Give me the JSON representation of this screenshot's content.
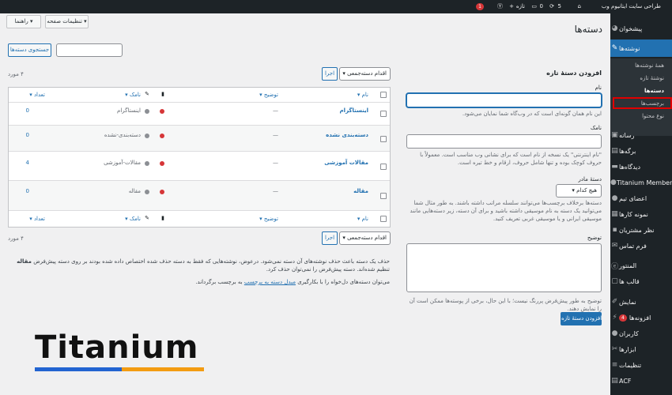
{
  "adminbar": {
    "site_name": "طراحی سایت ایتانیوم وب",
    "updates_count": "5",
    "comments_count": "0",
    "new_label": "تازه",
    "badge": "1"
  },
  "screen_buttons": {
    "help": "راهنما",
    "options": "تنظیمات صفحه"
  },
  "page_title": "دسته‌ها",
  "search": {
    "button": "جستجوی دسته‌ها",
    "placeholder": ""
  },
  "form": {
    "heading": "افزودن دستهٔ تازه",
    "name_label": "نام",
    "name_help": "این نام همان گونه‌ای است که در وب‌گاه شما نمایان می‌شود.",
    "slug_label": "نامک",
    "slug_help": "\"نام اینترنتی\" یک نسخه از نام است که برای نشانی وب مناسب است. معمولاً با حروف کوچک بوده و تنها شامل حروف، ارقام و خط تیره است.",
    "parent_label": "دستهٔ مادر",
    "parent_value": "هیچ کدام",
    "parent_help": "دسته‌ها برخلاف برچسب‌ها می‌توانند سلسله مراتب داشته باشند. به طور مثال شما می‌توانید یک دسته به نام موسیقی داشته باشید و برای آن دسته، زیر دسته‌هایی مانند موسیقی ایرانی و یا موسیقی غربی تعریف کنید.",
    "desc_label": "توضیح",
    "desc_help": "توضیح به طور پیش‌فرض پررنگ نیست؛ با این حال، برخی از پوسته‌ها ممکن است آن را نمایش دهند.",
    "submit": "افزودن دستهٔ تازه"
  },
  "bulk": {
    "select": "اقدام دسته‌جمعی",
    "apply": "اجرا",
    "count": "۴ مورد"
  },
  "table": {
    "headers": {
      "name": "نام",
      "description": "توضیح",
      "slug": "نامک",
      "count": "تعداد"
    },
    "rows": [
      {
        "name": "اینستاگرام",
        "description": "—",
        "slug": "اینستاگرام",
        "count": "0"
      },
      {
        "name": "دسته‌بندی نشده",
        "description": "—",
        "slug": "دسته‌بندی-نشده",
        "count": "0"
      },
      {
        "name": "مقالات آموزشی",
        "description": "—",
        "slug": "مقالات-آموزشی",
        "count": "4"
      },
      {
        "name": "مقاله",
        "description": "—",
        "slug": "مقاله",
        "count": "0"
      }
    ]
  },
  "notes": {
    "delete_note_1": "حذف یک دسته باعث حذف نوشته‌های آن دسته نمی‌شود. درعوض، نوشته‌هایی که فقط به دسته حذف شده اختصاص داده شده بودند بر روی دسته پیش‌فرض",
    "default_cat": "مقاله",
    "delete_note_2": "تنظیم شده‌اند. دسته پیش‌فرض را نمی‌توان حذف کرد.",
    "convert_prefix": "می‌توان دسته‌های دل‌خواه را با بکارگیری",
    "convert_link": "مبدل دسته به برچسب",
    "convert_suffix": "به برچسب برگرداند."
  },
  "sidebar": {
    "items": [
      {
        "label": "پیشخوان",
        "icon": "dashboard-icon"
      },
      {
        "label": "نوشته‌ها",
        "icon": "pin-icon",
        "active": true
      },
      {
        "label": "رسانه",
        "icon": "media-icon"
      },
      {
        "label": "برگه‌ها",
        "icon": "page-icon"
      },
      {
        "label": "دیدگاه‌ها",
        "icon": "comment-icon"
      },
      {
        "label": "Titanium Members",
        "icon": "members-icon"
      },
      {
        "label": "اعضای تیم",
        "icon": "team-icon"
      },
      {
        "label": "نمونه کارها",
        "icon": "portfolio-icon"
      },
      {
        "label": "نظر مشتریان",
        "icon": "testimonial-icon"
      },
      {
        "label": "فرم تماس",
        "icon": "mail-icon"
      },
      {
        "label": "المنتور",
        "icon": "elementor-icon"
      },
      {
        "label": "قالب ها",
        "icon": "template-icon"
      },
      {
        "label": "نمایش",
        "icon": "brush-icon"
      },
      {
        "label": "افزونه‌ها",
        "icon": "plugin-icon",
        "badge": "4"
      },
      {
        "label": "کاربران",
        "icon": "user-icon"
      },
      {
        "label": "ابزارها",
        "icon": "tools-icon"
      },
      {
        "label": "تنظیمات",
        "icon": "settings-icon"
      },
      {
        "label": "ACF",
        "icon": "acf-icon"
      }
    ],
    "submenu": [
      "همهٔ نوشته‌ها",
      "نوشتهٔ تازه",
      "دسته‌ها",
      "برچسب‌ها",
      "نوع محتوا"
    ]
  },
  "logo": {
    "text": "Titanium"
  },
  "colors": {
    "accent": "#2271b1",
    "sidebar": "#1d2327",
    "highlight": "#e00000"
  }
}
